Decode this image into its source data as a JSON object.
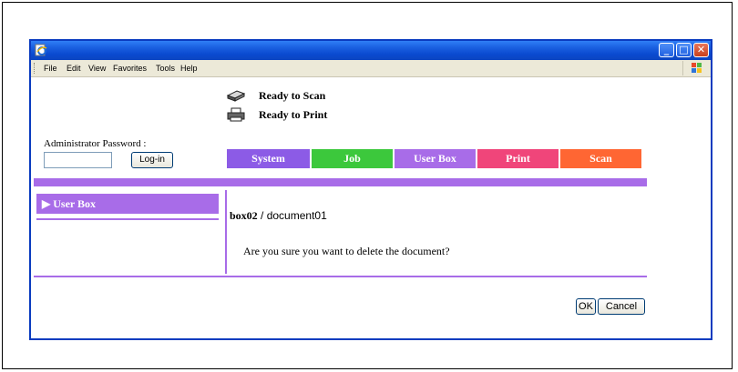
{
  "menu": [
    "File",
    "Edit",
    "View",
    "Favorites",
    "Tools",
    "Help"
  ],
  "status": {
    "scan": "Ready to Scan",
    "print": "Ready to Print"
  },
  "login": {
    "label": "Administrator Password :",
    "password_value": "",
    "button": "Log-in"
  },
  "tabs": [
    {
      "label": "System",
      "color": "#8c5be6"
    },
    {
      "label": "Job",
      "color": "#3cc83c"
    },
    {
      "label": "User Box",
      "color": "#a86ce8"
    },
    {
      "label": "Print",
      "color": "#f0457a"
    },
    {
      "label": "Scan",
      "color": "#ff6633"
    }
  ],
  "sidebar": {
    "active_label": "▶ User Box"
  },
  "main": {
    "box_name": "box02",
    "separator": " / ",
    "document_name": "document01",
    "confirm_text": "Are you sure you want to delete the document?"
  },
  "buttons": {
    "ok": "OK",
    "cancel": "Cancel"
  },
  "colors": {
    "accent_purple": "#a86ce8",
    "titlebar_blue": "#0a4ad0"
  }
}
